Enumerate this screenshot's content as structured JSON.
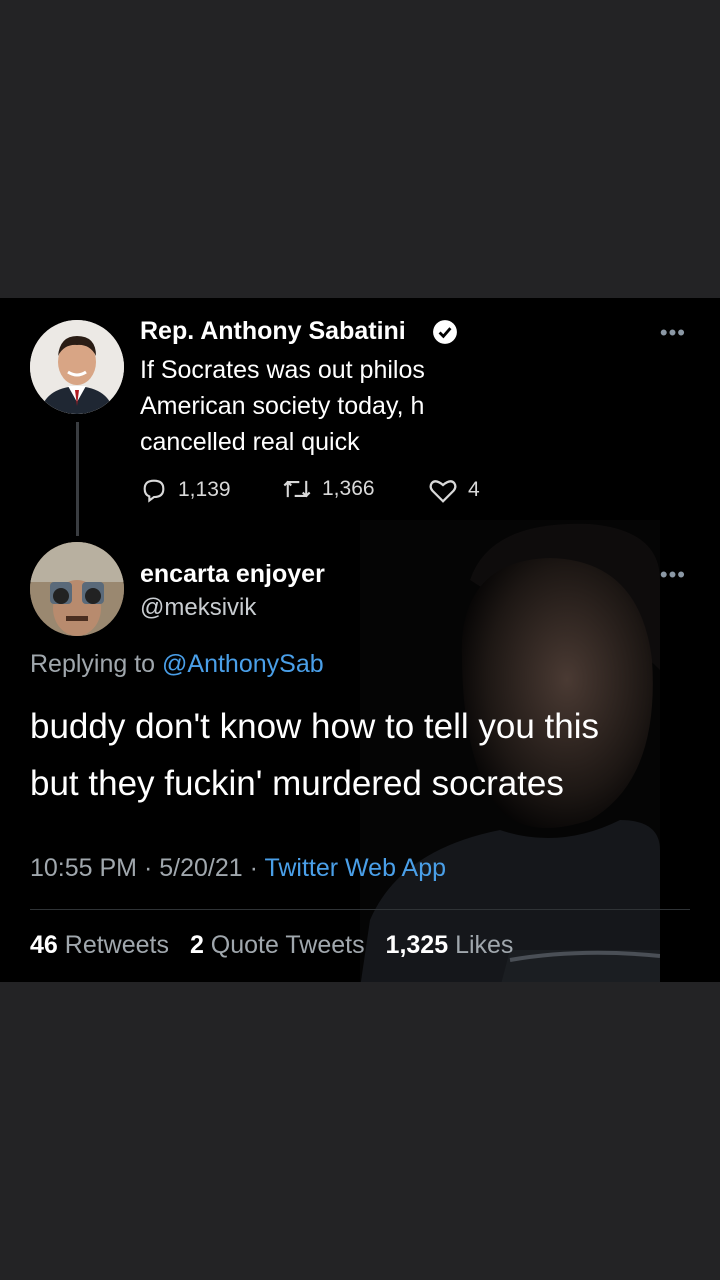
{
  "tweet1": {
    "name": "Rep. Anthony Sabatini",
    "lines": [
      "If Socrates was out philos",
      "American society today, h",
      "cancelled real quick"
    ],
    "replies": "1,139",
    "retweets": "1,366",
    "likes": "4"
  },
  "tweet2": {
    "name": "encarta enjoyer",
    "handle": "@meksivik",
    "replying_prefix": "Replying to ",
    "replying_mention": "@AnthonySab",
    "lines": [
      "buddy don't know how to tell you this",
      "but they fuckin' murdered socrates"
    ],
    "time": "10:55 PM",
    "date": "5/20/21",
    "app": "Twitter Web App",
    "retweets_count": "46",
    "retweets_label": "Retweets",
    "quotes_count": "2",
    "quotes_label": "Quote Tweets",
    "likes_count": "1,325",
    "likes_label": "Likes"
  },
  "colors": {
    "link": "#4a9fe8",
    "background": "#232325",
    "card": "#000000"
  },
  "icons": [
    "verified-badge-icon",
    "reply-icon",
    "retweet-icon",
    "like-icon",
    "more-icon"
  ]
}
